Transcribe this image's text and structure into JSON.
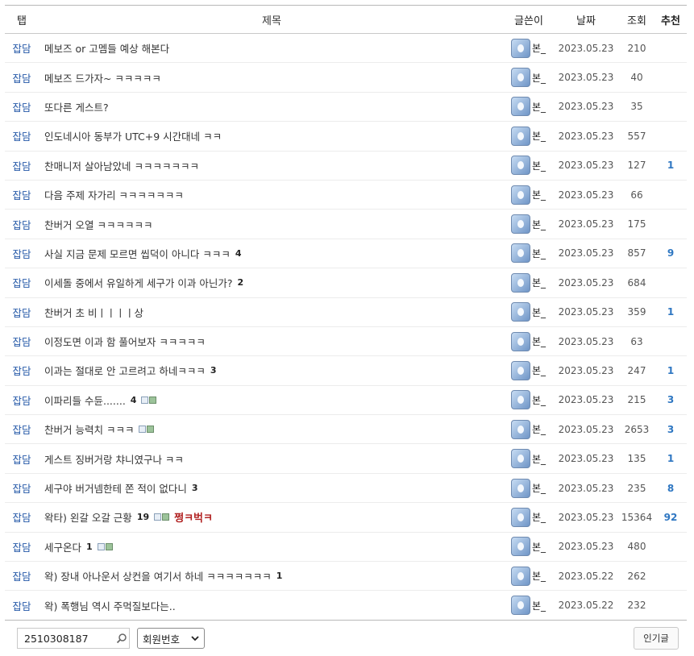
{
  "header": {
    "tab": "탭",
    "title": "제목",
    "writer": "글쓴이",
    "date": "날짜",
    "views": "조회",
    "recommend": "추천"
  },
  "rows": [
    {
      "tab": "잡담",
      "title": "메보즈 or 고멤들 예상 해본다",
      "comments": "",
      "attach": false,
      "badge": "",
      "writer": "본_",
      "date": "2023.05.23",
      "views": "210",
      "rec": ""
    },
    {
      "tab": "잡담",
      "title": "메보즈 드가자~ ㅋㅋㅋㅋㅋ",
      "comments": "",
      "attach": false,
      "badge": "",
      "writer": "본_",
      "date": "2023.05.23",
      "views": "40",
      "rec": ""
    },
    {
      "tab": "잡담",
      "title": "또다른 게스트?",
      "comments": "",
      "attach": false,
      "badge": "",
      "writer": "본_",
      "date": "2023.05.23",
      "views": "35",
      "rec": ""
    },
    {
      "tab": "잡담",
      "title": "인도네시아 동부가 UTC+9 시간대네 ㅋㅋ",
      "comments": "",
      "attach": false,
      "badge": "",
      "writer": "본_",
      "date": "2023.05.23",
      "views": "557",
      "rec": ""
    },
    {
      "tab": "잡담",
      "title": "찬매니저 살아남았네 ㅋㅋㅋㅋㅋㅋㅋ",
      "comments": "",
      "attach": false,
      "badge": "",
      "writer": "본_",
      "date": "2023.05.23",
      "views": "127",
      "rec": "1"
    },
    {
      "tab": "잡담",
      "title": "다음 주제 자가리 ㅋㅋㅋㅋㅋㅋㅋ",
      "comments": "",
      "attach": false,
      "badge": "",
      "writer": "본_",
      "date": "2023.05.23",
      "views": "66",
      "rec": ""
    },
    {
      "tab": "잡담",
      "title": "찬버거 오열 ㅋㅋㅋㅋㅋㅋ",
      "comments": "",
      "attach": false,
      "badge": "",
      "writer": "본_",
      "date": "2023.05.23",
      "views": "175",
      "rec": ""
    },
    {
      "tab": "잡담",
      "title": "사실 지금 문제 모르면 씹덕이 아니다 ㅋㅋㅋ",
      "comments": "4",
      "attach": false,
      "badge": "",
      "writer": "본_",
      "date": "2023.05.23",
      "views": "857",
      "rec": "9"
    },
    {
      "tab": "잡담",
      "title": "이세돌 중에서 유일하게 세구가 이과 아닌가?",
      "comments": "2",
      "attach": false,
      "badge": "",
      "writer": "본_",
      "date": "2023.05.23",
      "views": "684",
      "rec": ""
    },
    {
      "tab": "잡담",
      "title": "찬버거 초 비ㅣㅣㅣㅣ상",
      "comments": "",
      "attach": false,
      "badge": "",
      "writer": "본_",
      "date": "2023.05.23",
      "views": "359",
      "rec": "1"
    },
    {
      "tab": "잡담",
      "title": "이정도면 이과 함 풀어보자 ㅋㅋㅋㅋㅋ",
      "comments": "",
      "attach": false,
      "badge": "",
      "writer": "본_",
      "date": "2023.05.23",
      "views": "63",
      "rec": ""
    },
    {
      "tab": "잡담",
      "title": "이과는 절대로 안 고르려고 하네ㅋㅋㅋ",
      "comments": "3",
      "attach": false,
      "badge": "",
      "writer": "본_",
      "date": "2023.05.23",
      "views": "247",
      "rec": "1"
    },
    {
      "tab": "잡담",
      "title": "이파리들 수듄.......",
      "comments": "4",
      "attach": true,
      "badge": "",
      "writer": "본_",
      "date": "2023.05.23",
      "views": "215",
      "rec": "3"
    },
    {
      "tab": "잡담",
      "title": "찬버거 능력치 ㅋㅋㅋ",
      "comments": "",
      "attach": true,
      "badge": "",
      "writer": "본_",
      "date": "2023.05.23",
      "views": "2653",
      "rec": "3"
    },
    {
      "tab": "잡담",
      "title": "게스트 징버거랑 챠니였구나 ㅋㅋ",
      "comments": "",
      "attach": false,
      "badge": "",
      "writer": "본_",
      "date": "2023.05.23",
      "views": "135",
      "rec": "1"
    },
    {
      "tab": "잡담",
      "title": "세구야 버거넴한테 쫀 적이 없다니",
      "comments": "3",
      "attach": false,
      "badge": "",
      "writer": "본_",
      "date": "2023.05.23",
      "views": "235",
      "rec": "8"
    },
    {
      "tab": "잡담",
      "title": "왁타) 왼갈 오갈 근황",
      "comments": "19",
      "attach": true,
      "badge": "쩡ㅋ벅ㅋ",
      "writer": "본_",
      "date": "2023.05.23",
      "views": "15364",
      "rec": "92"
    },
    {
      "tab": "잡담",
      "title": "세구온다",
      "comments": "1",
      "attach": true,
      "badge": "",
      "writer": "본_",
      "date": "2023.05.23",
      "views": "480",
      "rec": ""
    },
    {
      "tab": "잡담",
      "title": "왁) 장내 아나운서 상컨을 여기서 하네 ㅋㅋㅋㅋㅋㅋㅋ",
      "comments": "1",
      "attach": false,
      "badge": "",
      "writer": "본_",
      "date": "2023.05.22",
      "views": "262",
      "rec": ""
    },
    {
      "tab": "잡담",
      "title": "왁) 폭행님 역시 주먹질보다는..",
      "comments": "",
      "attach": false,
      "badge": "",
      "writer": "본_",
      "date": "2023.05.22",
      "views": "232",
      "rec": ""
    }
  ],
  "footer": {
    "search_value": "2510308187",
    "select_value": "회원번호",
    "popular_label": "인기글"
  },
  "icons": {
    "search": "search-icon",
    "avatar": "avatar-icon",
    "attachment": "attachment-icon",
    "chevron": "chevron-down-icon"
  },
  "colors": {
    "tab": "#2559a8",
    "recommend": "#2f77c2",
    "badge": "#b22424"
  }
}
